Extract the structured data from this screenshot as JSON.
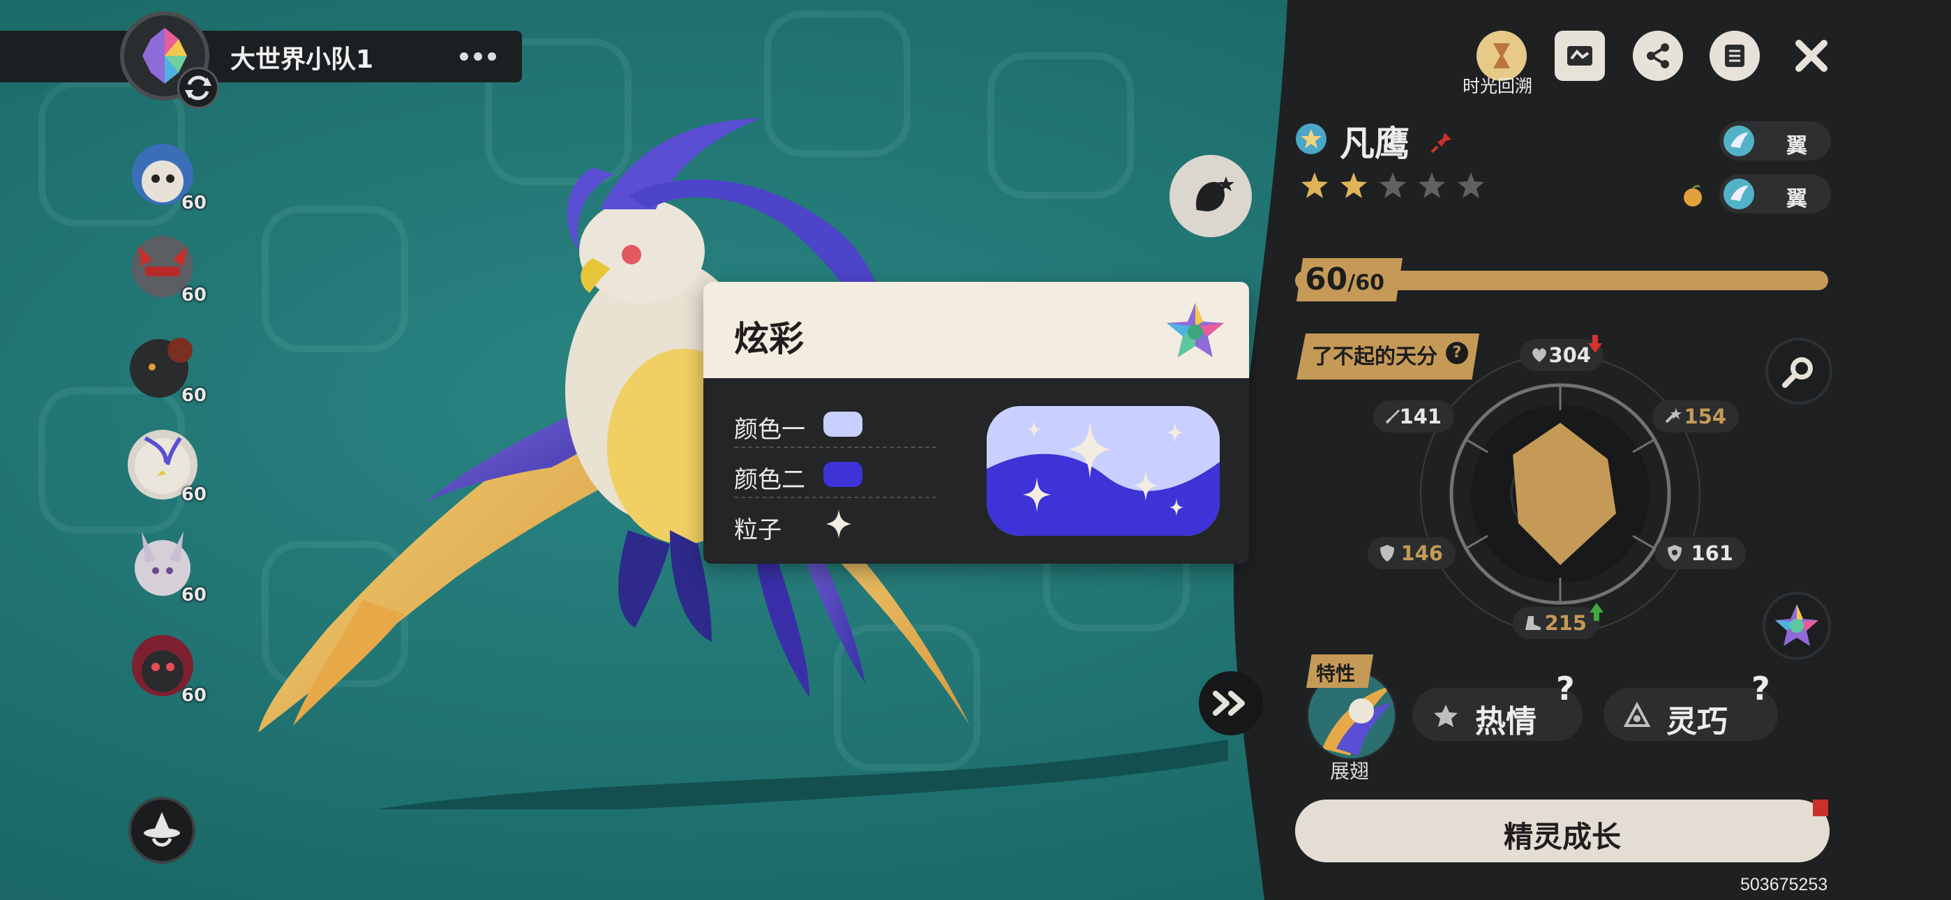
{
  "team": {
    "name": "大世界小队1"
  },
  "party": [
    {
      "level": "60"
    },
    {
      "level": "60"
    },
    {
      "level": "60"
    },
    {
      "level": "60"
    },
    {
      "level": "60"
    },
    {
      "level": "60"
    }
  ],
  "toolbar": {
    "rewind_label": "时光回溯"
  },
  "pet": {
    "name": "凡鹰",
    "stars_filled": 2,
    "stars_total": 5,
    "types": [
      {
        "label": "翼"
      },
      {
        "label": "翼"
      }
    ]
  },
  "level": {
    "current": "60",
    "max": "/60",
    "progress": 1.0
  },
  "talent": {
    "label": "了不起的天分",
    "help": "?"
  },
  "stats": {
    "hp": "304",
    "atk": "141",
    "matk": "154",
    "def": "146",
    "mdef": "161",
    "spd": "215"
  },
  "trait": {
    "tag": "特性",
    "name": "展翅"
  },
  "attributes": [
    {
      "label": "热情",
      "help": "?"
    },
    {
      "label": "灵巧",
      "help": "?"
    }
  ],
  "grow_button": {
    "label": "精灵成长"
  },
  "uid": "503675253",
  "popup": {
    "title": "炫彩",
    "rows": [
      {
        "label": "颜色一",
        "color": "#c9d0ff"
      },
      {
        "label": "颜色二",
        "color": "#3d33d6"
      },
      {
        "label": "粒子"
      }
    ]
  },
  "colors": {
    "accent_gold": "#c59a57",
    "panel_dark": "#1e2022",
    "scene_teal": "#1f6e6c",
    "stat_up": "#3fa83f",
    "stat_down": "#d8322d"
  }
}
